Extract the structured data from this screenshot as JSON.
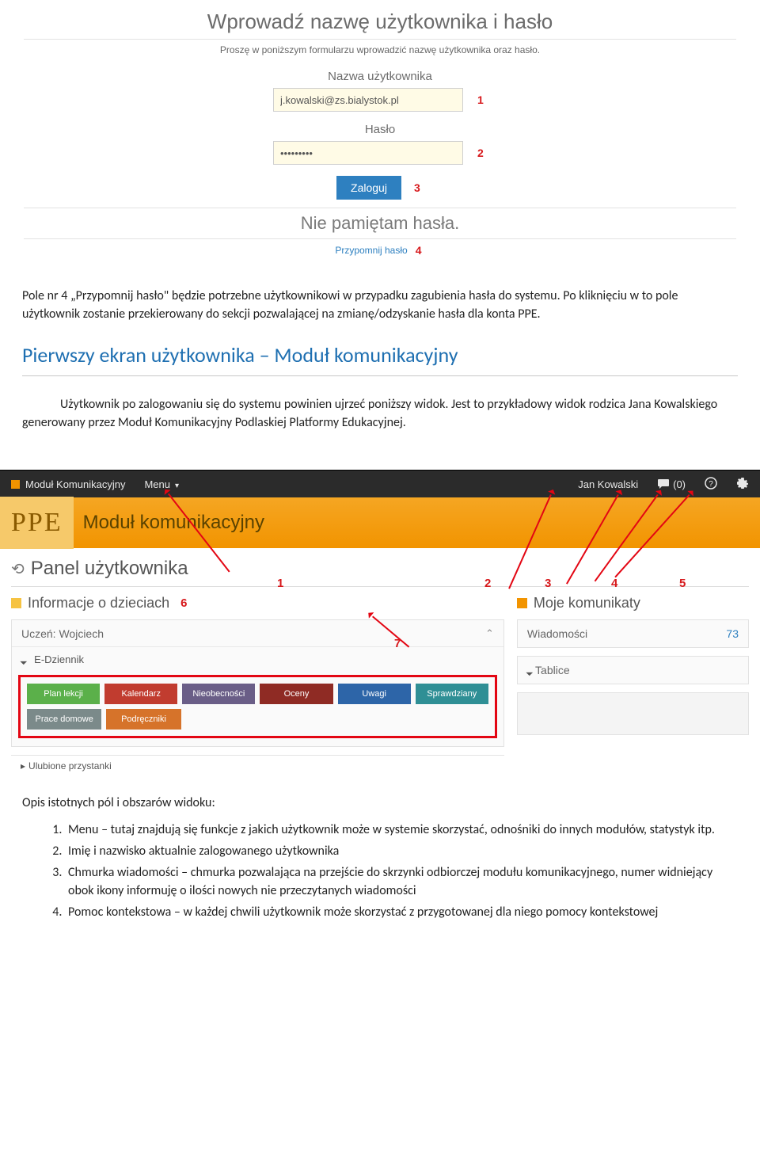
{
  "login": {
    "title": "Wprowadź nazwę użytkownika i hasło",
    "subtitle": "Proszę w poniższym formularzu wprowadzić nazwę użytkownika oraz hasło.",
    "username_label": "Nazwa użytkownika",
    "username_value": "j.kowalski@zs.bialystok.pl",
    "password_label": "Hasło",
    "password_value": "•••••••••",
    "login_button": "Zaloguj",
    "forgot_title": "Nie pamiętam hasła.",
    "remind_link": "Przypomnij hasło",
    "n1": "1",
    "n2": "2",
    "n3": "3",
    "n4": "4"
  },
  "body": {
    "p1": "Pole nr 4 „Przypomnij hasło\" będzie potrzebne użytkownikowi w przypadku zagubienia hasła do systemu. Po kliknięciu w to pole użytkownik zostanie przekierowany do sekcji pozwalającej na zmianę/odzyskanie hasła dla konta PPE.",
    "section_heading": "Pierwszy ekran użytkownika – Moduł komunikacyjny",
    "p2": "Użytkownik po zalogowaniu się do systemu powinien ujrzeć poniższy widok. Jest to przykładowy widok rodzica Jana Kowalskiego generowany przez Moduł Komunikacyjny Podlaskiej Platformy Edukacyjnej."
  },
  "panel": {
    "top": {
      "brand": "Moduł Komunikacyjny",
      "menu": "Menu",
      "user": "Jan Kowalski",
      "msg_count": "(0)"
    },
    "orange": {
      "ppe": "PPE",
      "title": "Moduł komunikacyjny"
    },
    "head_title": "Panel użytkownika",
    "left_title": "Informacje o dzieciach",
    "right_title": "Moje komunikaty",
    "student_label": "Uczeń: Wojciech",
    "ediary": "E-Dziennik",
    "tiles": {
      "plan": "Plan lekcji",
      "kal": "Kalendarz",
      "nieob": "Nieobecności",
      "oceny": "Oceny",
      "uwagi": "Uwagi",
      "spr": "Sprawdziany",
      "prace": "Prace domowe",
      "podr": "Podręczniki"
    },
    "right_msgs_label": "Wiadomości",
    "right_msgs_count": "73",
    "right_tablice": "Tablice",
    "bottom_cut": "Ulubione przystanki",
    "ann": {
      "n1": "1",
      "n2": "2",
      "n3": "3",
      "n4": "4",
      "n5": "5",
      "n6": "6",
      "n7": "7"
    }
  },
  "opis": {
    "intro": "Opis istotnych pól i obszarów widoku:",
    "i1": "Menu – tutaj znajdują się funkcje z jakich użytkownik może w systemie skorzystać, odnośniki do innych modułów, statystyk itp.",
    "i2": "Imię i nazwisko aktualnie zalogowanego użytkownika",
    "i3": "Chmurka wiadomości – chmurka pozwalająca na przejście do skrzynki odbiorczej modułu komunikacyjnego, numer widniejący obok ikony informuję o ilości nowych nie przeczytanych wiadomości",
    "i4": "Pomoc kontekstowa – w każdej chwili użytkownik może skorzystać z przygotowanej dla niego pomocy kontekstowej"
  }
}
